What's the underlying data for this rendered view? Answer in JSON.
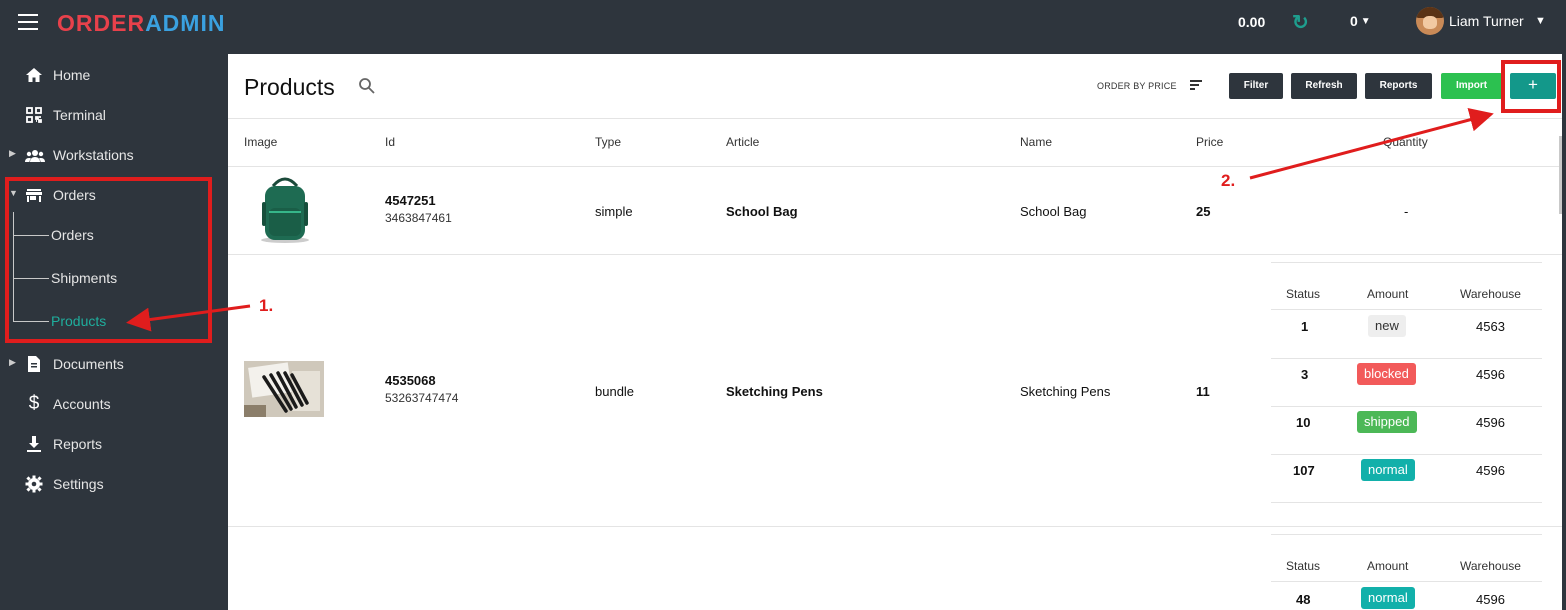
{
  "app": {
    "logo_part1": "ORDER",
    "logo_part2": "ADMIN",
    "balance": "0.00",
    "count": "0",
    "user_name": "Liam Turner"
  },
  "sidebar": {
    "items": [
      {
        "label": "Home",
        "icon": "home-icon"
      },
      {
        "label": "Terminal",
        "icon": "qr-code-icon"
      },
      {
        "label": "Workstations",
        "icon": "users-icon"
      },
      {
        "label": "Orders",
        "icon": "store-icon"
      },
      {
        "label": "Documents",
        "icon": "document-icon"
      },
      {
        "label": "Accounts",
        "icon": "dollar-icon"
      },
      {
        "label": "Reports",
        "icon": "download-icon"
      },
      {
        "label": "Settings",
        "icon": "gear-icon"
      }
    ],
    "orders_sub": [
      {
        "label": "Orders"
      },
      {
        "label": "Shipments"
      },
      {
        "label": "Products",
        "active": true
      }
    ]
  },
  "page": {
    "title": "Products",
    "order_by": "ORDER BY PRICE",
    "buttons": {
      "filter": "Filter",
      "refresh": "Refresh",
      "reports": "Reports",
      "import": "Import",
      "add": "+"
    }
  },
  "table": {
    "headers": [
      "Image",
      "Id",
      "Type",
      "Article",
      "Name",
      "Price",
      "Quantity"
    ],
    "rows": [
      {
        "id": "4547251",
        "sub_id": "3463847461",
        "type": "simple",
        "article": "School Bag",
        "name": "School Bag",
        "price": "25",
        "quantity": "-"
      },
      {
        "id": "4535068",
        "sub_id": "53263747474",
        "type": "bundle",
        "article": "Sketching Pens",
        "name": "Sketching Pens",
        "price": "11",
        "stock_headers": [
          "Status",
          "Amount",
          "Warehouse"
        ],
        "stock": [
          {
            "status": "1",
            "amount": "new",
            "warehouse": "4563"
          },
          {
            "status": "3",
            "amount": "blocked",
            "warehouse": "4596"
          },
          {
            "status": "10",
            "amount": "shipped",
            "warehouse": "4596"
          },
          {
            "status": "107",
            "amount": "normal",
            "warehouse": "4596"
          }
        ]
      },
      {
        "stock_headers": [
          "Status",
          "Amount",
          "Warehouse"
        ],
        "stock": [
          {
            "status": "48",
            "amount": "normal",
            "warehouse": "4596"
          }
        ]
      }
    ]
  },
  "annotations": {
    "step1": "1.",
    "step2": "2."
  },
  "colors": {
    "accent_teal": "#13988a",
    "active_link": "#1fae9d",
    "import_green": "#2cc150",
    "annotation_red": "#e01d1d",
    "badge_new": "#eeeeee",
    "badge_blocked": "#f25a5a",
    "badge_shipped": "#4cb857",
    "badge_normal": "#12b0aa"
  }
}
